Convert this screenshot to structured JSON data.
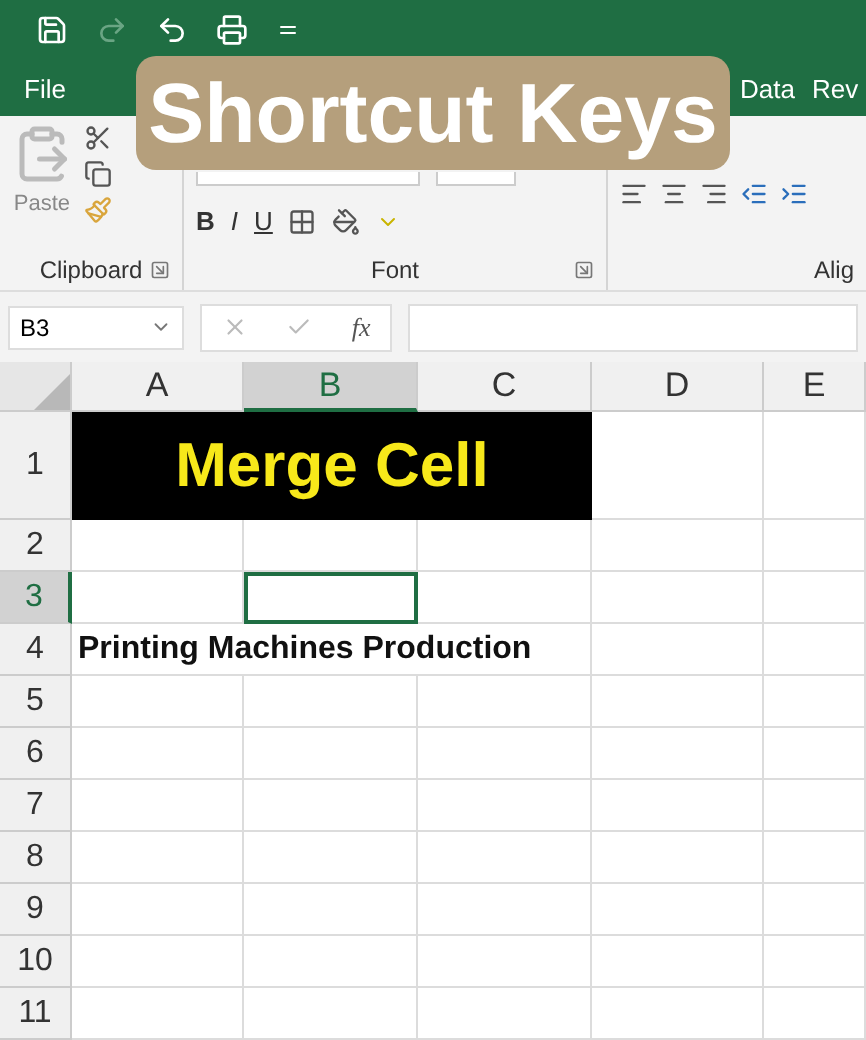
{
  "tabs": [
    {
      "label": "File",
      "selected": false
    },
    {
      "label": "Data",
      "selected": false
    },
    {
      "label": "Rev",
      "selected": false
    }
  ],
  "overlay_title": "Shortcut Keys",
  "ribbon": {
    "paste_label": "Paste",
    "font_buttons": [
      "B",
      "I",
      "U"
    ],
    "groups": [
      "Clipboard",
      "Font",
      "Alig"
    ]
  },
  "name_box": "B3",
  "formula_icon": "fx",
  "columns": [
    {
      "label": "A",
      "selected": false
    },
    {
      "label": "B",
      "selected": true
    },
    {
      "label": "C",
      "selected": false
    },
    {
      "label": "D",
      "selected": false
    },
    {
      "label": "E",
      "selected": false
    }
  ],
  "rows": [
    {
      "label": "1",
      "selected": false,
      "cells": [
        {
          "text": "Merge Cell",
          "kind": "merged-title"
        }
      ]
    },
    {
      "label": "2",
      "selected": false
    },
    {
      "label": "3",
      "selected": true
    },
    {
      "label": "4",
      "selected": false,
      "cells": [
        {
          "text": "Printing Machines Production",
          "kind": "bold-text"
        }
      ]
    },
    {
      "label": "5",
      "selected": false
    },
    {
      "label": "6",
      "selected": false
    },
    {
      "label": "7",
      "selected": false
    },
    {
      "label": "8",
      "selected": false
    },
    {
      "label": "9",
      "selected": false
    },
    {
      "label": "10",
      "selected": false
    },
    {
      "label": "11",
      "selected": false
    }
  ]
}
